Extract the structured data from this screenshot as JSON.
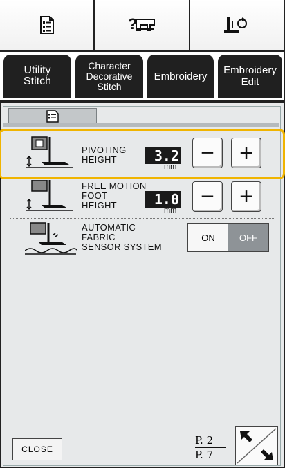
{
  "topbar": {
    "buttons": [
      {
        "icon": "settings-sheet-icon"
      },
      {
        "icon": "help-machine-icon"
      },
      {
        "icon": "needle-position-icon"
      }
    ]
  },
  "tabs": [
    {
      "label": "Utility\nStitch"
    },
    {
      "label": "Character\nDecorative\nStitch"
    },
    {
      "label": "Embroidery"
    },
    {
      "label": "Embroidery\nEdit"
    }
  ],
  "settings": {
    "subtab_icon": "settings-page-icon",
    "pivoting": {
      "label": "PIVOTING\nHEIGHT",
      "value": "3.2",
      "unit": "mm",
      "minus": "−",
      "plus": "+"
    },
    "free_motion": {
      "label": "FREE MOTION\nFOOT\nHEIGHT",
      "value": "1.0",
      "unit": "mm",
      "minus": "−",
      "plus": "+"
    },
    "fabric_sensor": {
      "label": "AUTOMATIC\nFABRIC\nSENSOR SYSTEM",
      "on": "ON",
      "off": "OFF",
      "state": "off"
    }
  },
  "footer": {
    "close_label": "CLOSE",
    "page_current": "P. 2",
    "page_total": "P. 7"
  },
  "colors": {
    "highlight": "#f0b400",
    "tab": "#202020",
    "panel": "#e7e9ea"
  }
}
